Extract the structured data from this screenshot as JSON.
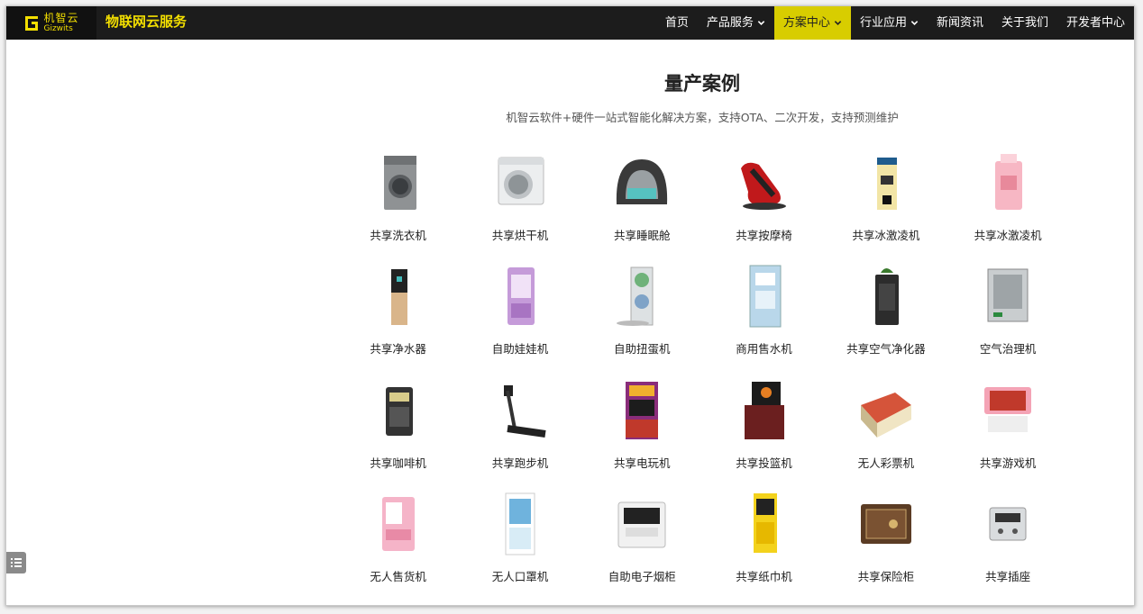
{
  "header": {
    "logo_cn": "机智云",
    "logo_en": "Gizwits",
    "brand": "物联网云服务",
    "menu": [
      {
        "label": "首页",
        "dropdown": false,
        "active": false
      },
      {
        "label": "产品服务",
        "dropdown": true,
        "active": false
      },
      {
        "label": "方案中心",
        "dropdown": true,
        "active": true
      },
      {
        "label": "行业应用",
        "dropdown": true,
        "active": false
      },
      {
        "label": "新闻资讯",
        "dropdown": false,
        "active": false
      },
      {
        "label": "关于我们",
        "dropdown": false,
        "active": false
      },
      {
        "label": "开发者中心",
        "dropdown": false,
        "active": false
      }
    ]
  },
  "colors": {
    "nav_bg": "#1c1c1c",
    "accent": "#f3df00",
    "active_bg": "#d8cd00"
  },
  "section": {
    "title": "量产案例",
    "subtitle": "机智云软件+硬件一站式智能化解决方案，支持OTA、二次开发，支持预测维护"
  },
  "cases": [
    {
      "label": "共享洗衣机",
      "icon": "washing-machine-icon"
    },
    {
      "label": "共享烘干机",
      "icon": "dryer-icon"
    },
    {
      "label": "共享睡眠舱",
      "icon": "sleep-pod-icon"
    },
    {
      "label": "共享按摩椅",
      "icon": "massage-chair-icon"
    },
    {
      "label": "共享冰激凌机",
      "icon": "ice-cream-machine-icon"
    },
    {
      "label": "共享冰激凌机",
      "icon": "ice-cream-machine-pink-icon"
    },
    {
      "label": "共享净水器",
      "icon": "water-purifier-icon"
    },
    {
      "label": "自助娃娃机",
      "icon": "claw-machine-icon"
    },
    {
      "label": "自助扭蛋机",
      "icon": "gacha-machine-icon"
    },
    {
      "label": "商用售水机",
      "icon": "water-vending-icon"
    },
    {
      "label": "共享空气净化器",
      "icon": "air-purifier-icon"
    },
    {
      "label": "空气治理机",
      "icon": "air-treatment-icon"
    },
    {
      "label": "共享咖啡机",
      "icon": "coffee-machine-icon"
    },
    {
      "label": "共享跑步机",
      "icon": "treadmill-icon"
    },
    {
      "label": "共享电玩机",
      "icon": "arcade-machine-icon"
    },
    {
      "label": "共享投篮机",
      "icon": "basketball-machine-icon"
    },
    {
      "label": "无人彩票机",
      "icon": "lottery-machine-icon"
    },
    {
      "label": "共享游戏机",
      "icon": "game-machine-icon"
    },
    {
      "label": "无人售货机",
      "icon": "vending-machine-icon"
    },
    {
      "label": "无人口罩机",
      "icon": "mask-machine-icon"
    },
    {
      "label": "自助电子烟柜",
      "icon": "e-cig-cabinet-icon"
    },
    {
      "label": "共享纸巾机",
      "icon": "tissue-machine-icon"
    },
    {
      "label": "共享保险柜",
      "icon": "safe-icon"
    },
    {
      "label": "共享插座",
      "icon": "power-socket-icon"
    }
  ],
  "float_button": {
    "icon": "list-menu-icon"
  }
}
